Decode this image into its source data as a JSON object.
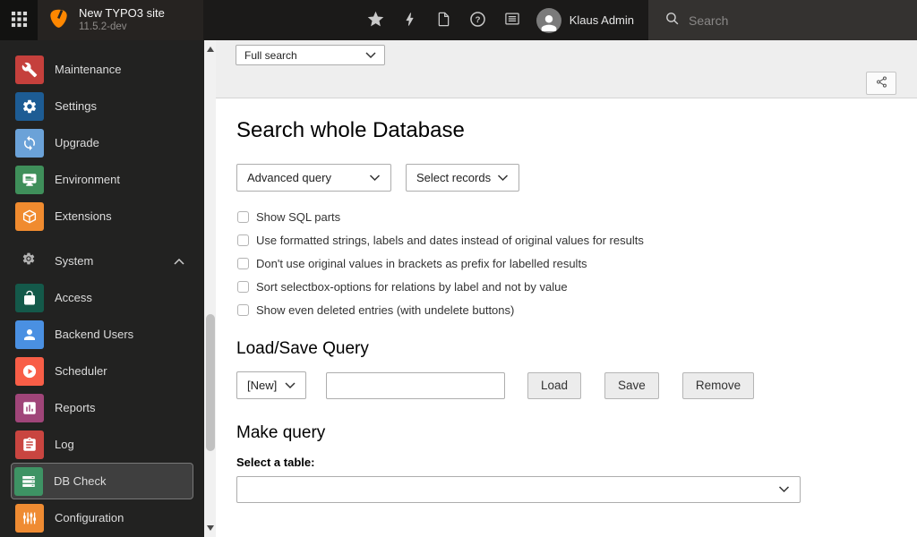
{
  "topbar": {
    "site_title": "New TYPO3 site",
    "site_version": "11.5.2-dev",
    "user_name": "Klaus Admin",
    "search_placeholder": "Search"
  },
  "colors": {
    "logo_orange": "#ff8700",
    "topbar_bg": "#1b1a19",
    "sidebar_bg": "#222221",
    "selected_item_bg": "#3f3f3f",
    "docheader_bg": "#eeeeee"
  },
  "sidebar": {
    "items": [
      {
        "label": "Maintenance",
        "color": "#c5403c"
      },
      {
        "label": "Settings",
        "color": "#1d5c94"
      },
      {
        "label": "Upgrade",
        "color": "#6ba2d8"
      },
      {
        "label": "Environment",
        "color": "#3f8f5a"
      },
      {
        "label": "Extensions",
        "color": "#f08b2f"
      },
      {
        "label": "System"
      },
      {
        "label": "Access",
        "color": "#14594a"
      },
      {
        "label": "Backend Users",
        "color": "#4a90e2"
      },
      {
        "label": "Scheduler",
        "color": "#f85e47"
      },
      {
        "label": "Reports",
        "color": "#a04579"
      },
      {
        "label": "Log",
        "color": "#c94540"
      },
      {
        "label": "DB Check",
        "color": "#3e9364",
        "selected": true
      },
      {
        "label": "Configuration",
        "color": "#ef8b32"
      }
    ]
  },
  "docheader": {
    "module_menu_value": "Full search"
  },
  "main": {
    "title": "Search whole Database",
    "query_type_value": "Advanced query",
    "record_select_value": "Select records",
    "options": [
      "Show SQL parts",
      "Use formatted strings, labels and dates instead of original values for results",
      "Don't use original values in brackets as prefix for labelled results",
      "Sort selectbox-options for relations by label and not by value",
      "Show even deleted entries (with undelete buttons)"
    ],
    "load_save": {
      "title": "Load/Save Query",
      "stored_query_value": "[New]",
      "query_name_value": "",
      "load_label": "Load",
      "save_label": "Save",
      "remove_label": "Remove"
    },
    "make_query": {
      "title": "Make query",
      "table_label": "Select a table:",
      "table_value": ""
    }
  }
}
